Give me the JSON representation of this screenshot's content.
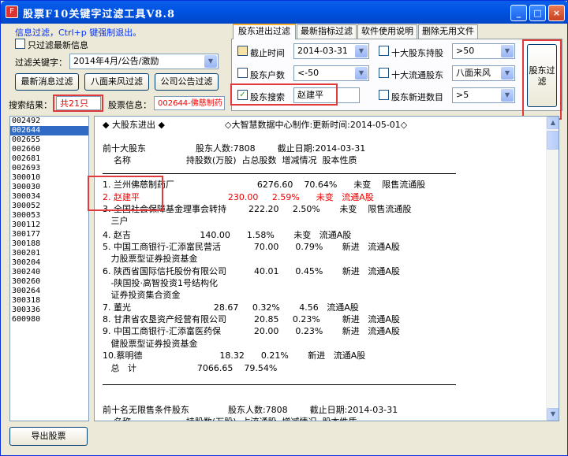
{
  "window": {
    "title": "股票F10关键字过滤工具V8.8",
    "min": "_",
    "max": "□",
    "close": "×"
  },
  "left": {
    "hint": "信息过滤，Ctrl+p 键强制退出。",
    "latest_only_label": "只过滤最新信息",
    "keyword_label": "过滤关键字：",
    "keyword_value": "2014年4月/公告/激励",
    "btn_latest": "最新消息过滤",
    "btn_eight": "八面来风过滤",
    "btn_notice": "公司公告过滤",
    "result_label": "搜索结果：",
    "result_value": "共21只",
    "stock_info_label": "股票信息：",
    "stock_info_value": "002644-佛慈制药",
    "export_button": "导出股票"
  },
  "tabs": [
    "股东进出过滤",
    "最新指标过滤",
    "软件使用说明",
    "删除无用文件"
  ],
  "filters": {
    "cutoff_label": "截止时间",
    "cutoff_value": "2014-03-31",
    "holders_label": "股东户数",
    "holders_value": "<-50",
    "search_label": "股东搜索",
    "search_value": "赵建平",
    "top10_label": "十大股东持股",
    "top10_value": ">50",
    "top10_float_label": "十大流通股东",
    "top10_float_value": "八面来风",
    "new_holder_label": "股东新进数目",
    "new_holder_value": ">5",
    "filter_button": "股东过滤"
  },
  "stock_list": [
    "002492",
    "002644",
    "002655",
    "002660",
    "002681",
    "002693",
    "300010",
    "300030",
    "300034",
    "300052",
    "300053",
    "300112",
    "300177",
    "300188",
    "300201",
    "300204",
    "300240",
    "300260",
    "300264",
    "300318",
    "300336",
    "600980"
  ],
  "selected_stock": "002644",
  "content": {
    "header": "◆ 大股东进出 ◆",
    "source": "◇大智慧数据中心制作:更新时间:2014-05-01◇",
    "lines": [
      {
        "t": "前十大股东                  股东人数:7808        截止日期:2014-03-31"
      },
      {
        "t": "    名称                    持股数(万股)  占总股数  增减情况  股本性质"
      },
      {
        "t": "1. 兰州佛慈制药厂                              6276.60    70.64%      未变    限售流通股"
      },
      {
        "t": "2. 赵建平                                230.00     2.59%      未变   流通A股",
        "red": true
      },
      {
        "t": "3. 全国社会保障基金理事会转持        222.20     2.50%       未变    限售流通股"
      },
      {
        "t": "   三户"
      },
      {
        "t": "4. 赵吉                         140.00      1.58%       未变   流通A股"
      },
      {
        "t": "5. 中国工商银行-汇添富民营活            70.00      0.79%       新进   流通A股"
      },
      {
        "t": "   力股票型证券投资基金"
      },
      {
        "t": "6. 陕西省国际信托股份有限公司          40.01      0.45%       新进   流通A股"
      },
      {
        "t": "   -陕国投·高智投资1号结构化"
      },
      {
        "t": "   证券投资集合资金"
      },
      {
        "t": "7. 董光                              28.67     0.32%       4.56   流通A股"
      },
      {
        "t": "8. 甘肃省农垦资产经营有限公司          20.85     0.23%        新进   流通A股"
      },
      {
        "t": "9. 中国工商银行-汇添富医药保            20.00      0.23%       新进   流通A股"
      },
      {
        "t": "   健股票型证券投资基金"
      },
      {
        "t": "10.蔡明德                            18.32      0.21%       新进   流通A股"
      },
      {
        "t": "   总   计                      7066.65    79.54%"
      }
    ],
    "lines2": [
      {
        "t": "前十名无限售条件股东              股东人数:7808        截止日期:2014-03-31"
      },
      {
        "t": "    名称                    持股数(万股)  占流通股  增减情况  股本性质"
      }
    ]
  }
}
